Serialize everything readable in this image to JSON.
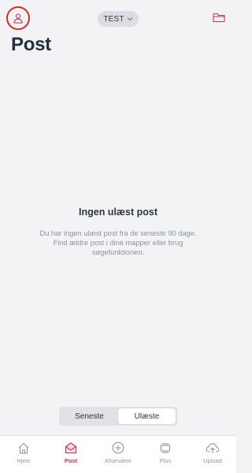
{
  "header": {
    "account_label": "TEST",
    "title": "Post"
  },
  "icons": {
    "profile": "person-icon",
    "account_dropdown": "chevron-down-icon",
    "folder": "folder-icon"
  },
  "empty_state": {
    "title": "Ingen ulæst post",
    "line1": "Du har ingen ulæst post fra de seneste 90 dage.",
    "line2": "Find ældre post i dine mapper eller brug",
    "line3": "søgefunktionen."
  },
  "filter": {
    "options": [
      "Seneste",
      "Ulæste"
    ],
    "selected": "Ulæste"
  },
  "tabs": [
    {
      "label": "Hjem",
      "icon": "home-icon"
    },
    {
      "label": "Post",
      "icon": "mail-icon",
      "active": true
    },
    {
      "label": "Afsendere",
      "icon": "plus-circle-icon"
    },
    {
      "label": "Plus",
      "icon": "plus-layers-icon"
    },
    {
      "label": "Upload",
      "icon": "cloud-upload-icon"
    }
  ],
  "colors": {
    "accent": "#b73a52",
    "highlight_ring": "#d62b2b",
    "background": "#f3f3f6"
  }
}
